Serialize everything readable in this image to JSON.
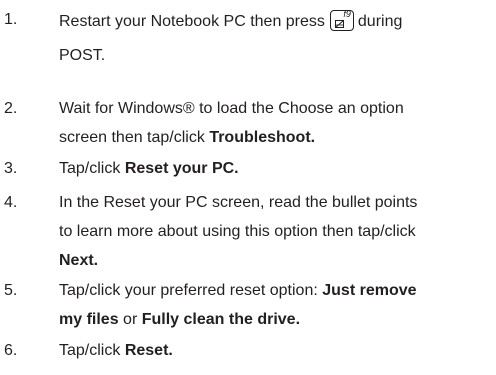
{
  "steps": [
    {
      "number": "1.",
      "line1_before": "Restart your Notebook PC then press",
      "key_label": "f9",
      "line1_after": "during",
      "line2": "POST."
    },
    {
      "number": "2.",
      "line1": "Wait for Windows® to load the Choose an option",
      "line2_before": "screen then tap/click",
      "line2_bold": "Troubleshoot."
    },
    {
      "number": "3.",
      "before": "Tap/click",
      "bold": "Reset your PC."
    },
    {
      "number": "4.",
      "line1": "In the Reset your PC screen, read the bullet points",
      "line2": "to learn more about using this option then tap/click",
      "line3_bold": "Next."
    },
    {
      "number": "5.",
      "line1_before": "Tap/click your preferred reset option:",
      "line1_bold": "Just remove",
      "line2_bold1": "my files",
      "line2_mid": "or",
      "line2_bold2": "Fully clean the drive."
    },
    {
      "number": "6.",
      "before": "Tap/click",
      "bold": "Reset."
    }
  ]
}
